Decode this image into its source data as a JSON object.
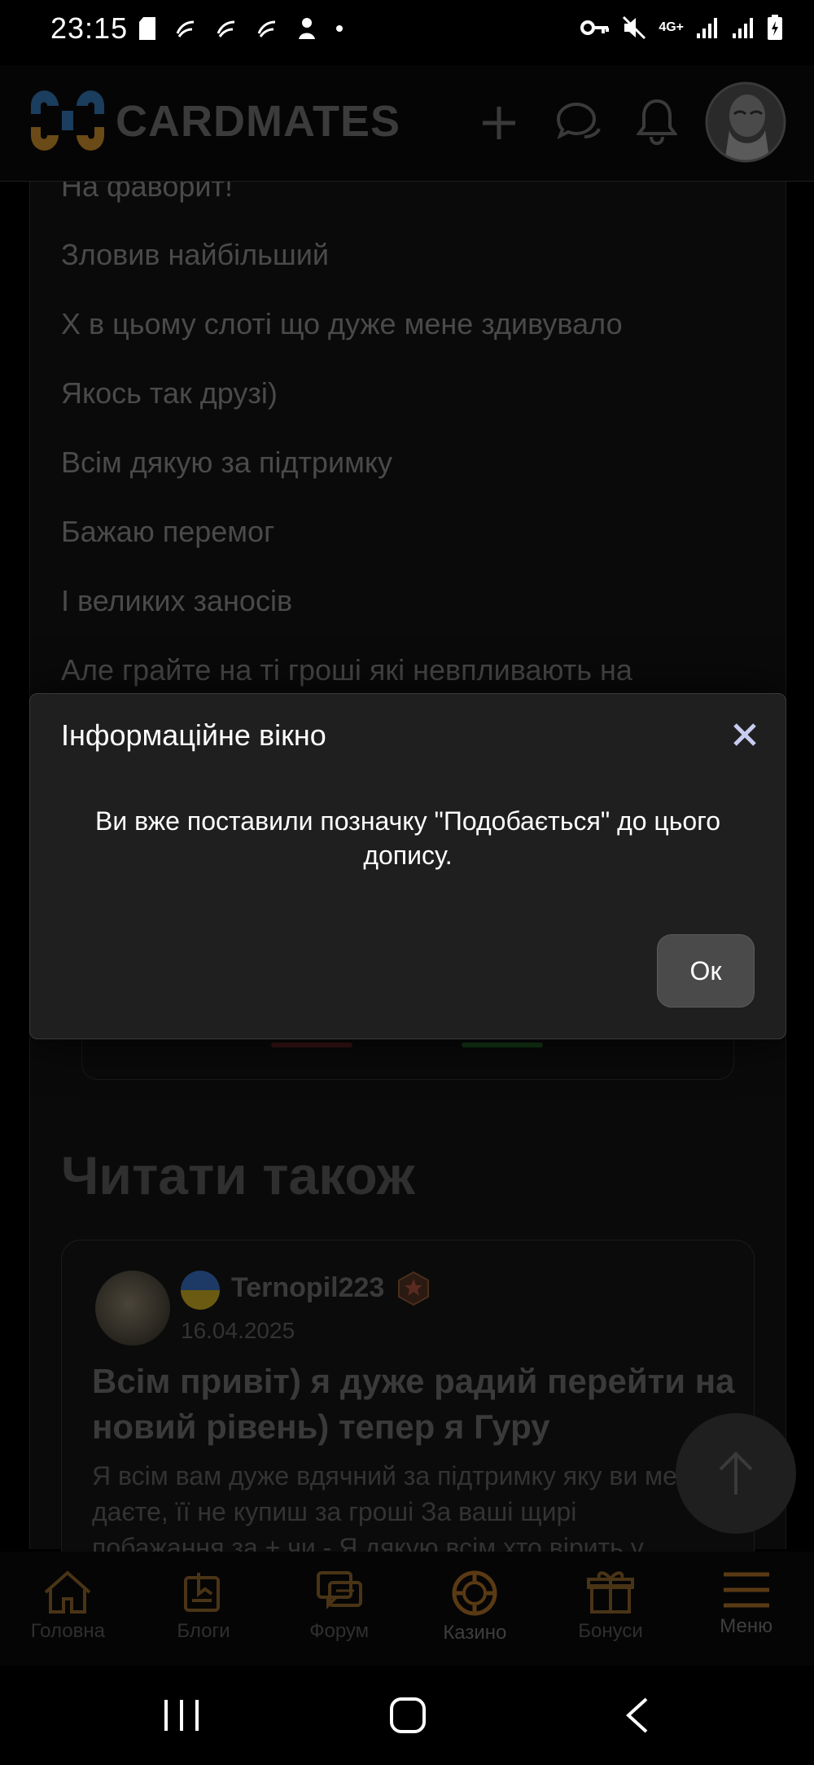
{
  "status_bar": {
    "time": "23:15",
    "network": "4G+"
  },
  "header": {
    "brand": "CARDMATES"
  },
  "post": {
    "lines": [
      "На фаворит!",
      "Зловив найбільший",
      "Х в цьому слоті що дуже мене здивувало",
      "Якось так друзі)",
      "Всім дякую за підтримку",
      "Бажаю перемог",
      "І великих заносів",
      "Але грайте на ті гроші які невпливають на"
    ]
  },
  "read_also": {
    "heading": "Читати також",
    "card": {
      "username": "Ternopil223",
      "date": "16.04.2025",
      "title": "Всім привіт) я дуже радий перейти на новий рівень) тепер я Гуру",
      "excerpt": "Я всім вам дуже вдячний за підтримку яку ви мені даєте, її не купиш за гроші За ваші щирі побажання за + чи - Я дякую всім хто вірить у"
    }
  },
  "dialog": {
    "title": "Інформаційне вікно",
    "message": "Ви вже поставили позначку \"Подобається\" до цього допису.",
    "ok_label": "Ок"
  },
  "bottom_nav": {
    "items": [
      {
        "label": "Головна",
        "icon": "home-icon"
      },
      {
        "label": "Блоги",
        "icon": "blog-icon"
      },
      {
        "label": "Форум",
        "icon": "forum-icon"
      },
      {
        "label": "Казино",
        "icon": "casino-chip-icon"
      },
      {
        "label": "Бонуси",
        "icon": "gift-icon"
      },
      {
        "label": "Меню",
        "icon": "hamburger-menu-icon"
      }
    ]
  },
  "colors": {
    "accent": "#c88a2e",
    "dim_text": "#4a4a4a",
    "dialog_bg": "#1f1f1f"
  }
}
